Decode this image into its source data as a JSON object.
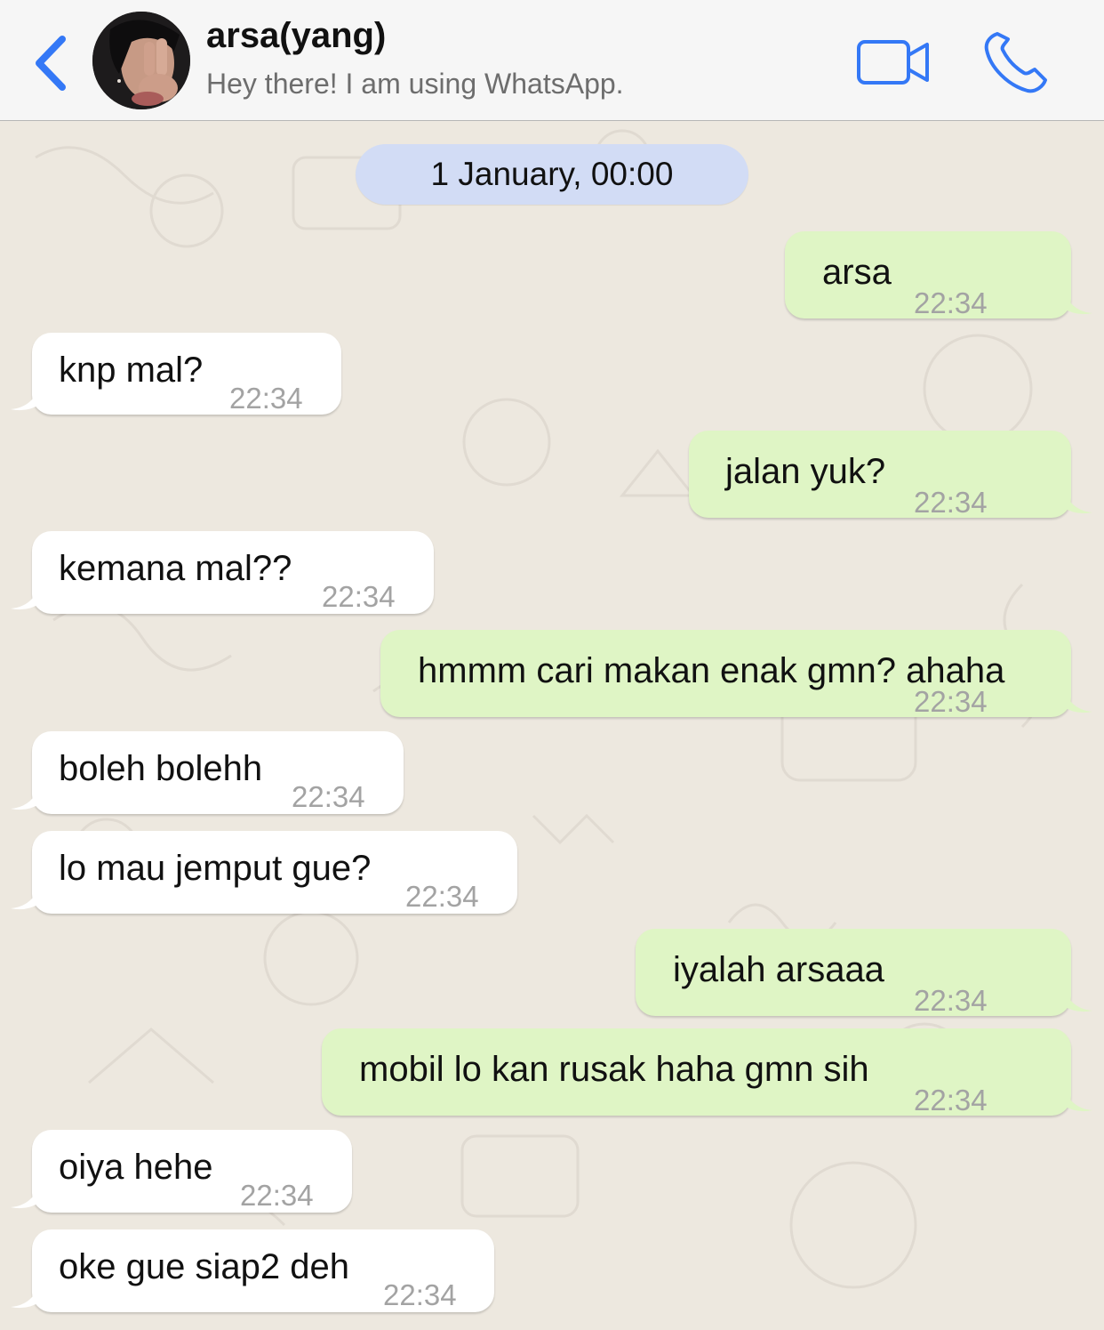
{
  "header": {
    "contact_name": "arsa(yang)",
    "contact_status": "Hey there! I am using WhatsApp.",
    "back_icon": "chevron-left-icon",
    "video_icon": "video-camera-icon",
    "phone_icon": "phone-icon",
    "accent_color": "#3478f6"
  },
  "chat": {
    "date_label": "1 January, 00:00",
    "messages": [
      {
        "direction": "out",
        "text": "arsa",
        "time": "22:34"
      },
      {
        "direction": "in",
        "text": "knp mal?",
        "time": "22:34"
      },
      {
        "direction": "out",
        "text": "jalan yuk?",
        "time": "22:34"
      },
      {
        "direction": "in",
        "text": "kemana mal??",
        "time": "22:34"
      },
      {
        "direction": "out",
        "text": "hmmm cari makan enak gmn? ahaha",
        "time": "22:34"
      },
      {
        "direction": "in",
        "text": "boleh bolehh",
        "time": "22:34"
      },
      {
        "direction": "in",
        "text": "lo mau jemput gue?",
        "time": "22:34"
      },
      {
        "direction": "out",
        "text": "iyalah arsaaa",
        "time": "22:34"
      },
      {
        "direction": "out",
        "text": "mobil lo kan rusak haha gmn sih",
        "time": "22:34"
      },
      {
        "direction": "in",
        "text": "oiya hehe",
        "time": "22:34"
      },
      {
        "direction": "in",
        "text": "oke gue siap2 deh",
        "time": "22:34"
      }
    ]
  }
}
